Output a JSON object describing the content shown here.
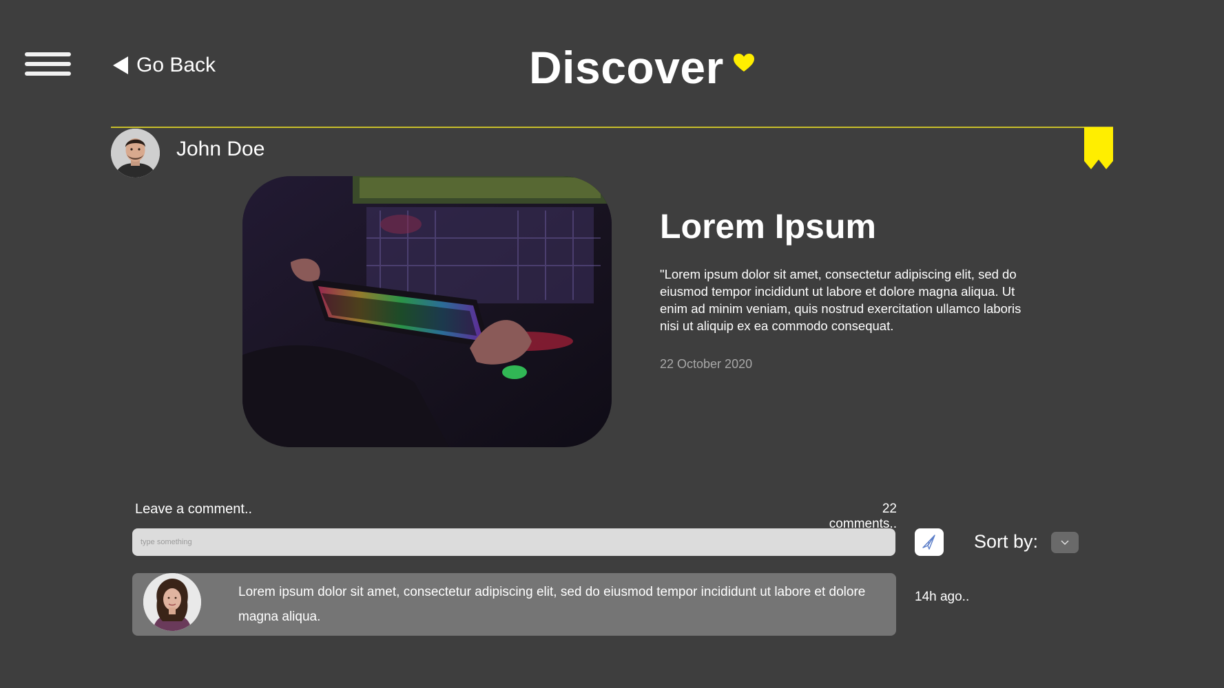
{
  "header": {
    "title": "Discover",
    "back_label": "Go Back"
  },
  "icons": {
    "menu": "hamburger-menu-icon",
    "back": "back-arrow-icon",
    "favorite": "heart-icon",
    "bookmark": "bookmark-icon",
    "send": "paper-plane-icon",
    "sort": "chevron-down-icon"
  },
  "colors": {
    "background": "#3e3e3e",
    "accent": "#ffee00",
    "divider": "#c9c02a",
    "input_bg": "#dcdcdc",
    "comment_card_bg": "#757575"
  },
  "author": {
    "name": "John Doe"
  },
  "post": {
    "title": "Lorem Ipsum",
    "body": "\"Lorem ipsum dolor sit amet, consectetur adipiscing elit, sed do eiusmod tempor incididunt ut labore et dolore magna aliqua. Ut enim ad minim veniam, quis nostrud exercitation ullamco laboris nisi ut aliquip ex ea commodo consequat.",
    "date": "22 October 2020"
  },
  "comments": {
    "prompt": "Leave a comment..",
    "count_label": "22 comments..",
    "input_placeholder": "type something",
    "sort_label": "Sort by:",
    "items": [
      {
        "text": "Lorem ipsum dolor sit amet, consectetur adipiscing elit, sed do eiusmod tempor incididunt ut labore et dolore magna aliqua.",
        "time": "14h ago.."
      }
    ]
  }
}
